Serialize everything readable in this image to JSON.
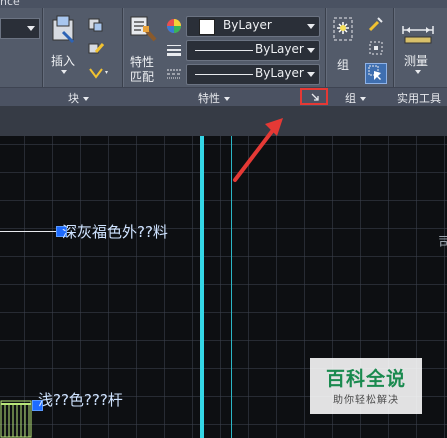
{
  "titlebar": {
    "text": "nce"
  },
  "ribbon": {
    "block_panel": {
      "insert_label": "插入",
      "panel_label": "块"
    },
    "properties_panel": {
      "match_label_line1": "特性",
      "match_label_line2": "匹配",
      "color_value": "ByLayer",
      "linetype_value": "ByLayer",
      "lineweight_value": "ByLayer",
      "panel_label": "特性"
    },
    "group_panel": {
      "group_label": "组",
      "panel_label": "组"
    },
    "utilities_panel": {
      "measure_label": "测量",
      "panel_label": "实用工具"
    }
  },
  "canvas": {
    "label_top": "深灰福色外??料",
    "label_bottom": "浅??色???杆",
    "edge_char": "司"
  },
  "watermark": {
    "title": "百科全说",
    "subtitle": "助你轻松解决"
  },
  "colors": {
    "ribbon_bg": "#535b6a",
    "canvas_bg": "#0d0f12",
    "cyan_line": "#34d6e6",
    "highlight_red": "#e53935",
    "grip_blue": "#1e6bff"
  }
}
